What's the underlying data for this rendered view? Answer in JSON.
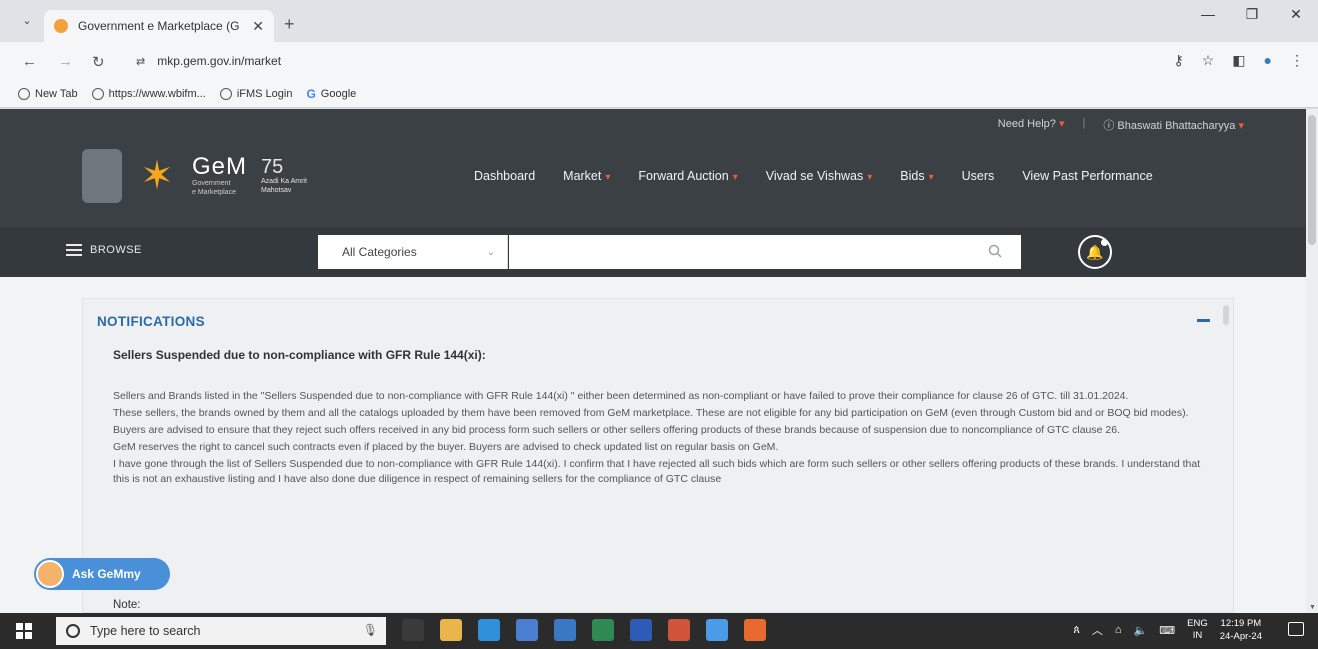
{
  "browser": {
    "tab_title": "Government e Marketplace (G",
    "url": "mkp.gem.gov.in/market",
    "bookmarks": [
      {
        "label": "New Tab",
        "icon": "globe-icon"
      },
      {
        "label": "https://www.wbifm...",
        "icon": "globe-icon"
      },
      {
        "label": "iFMS Login",
        "icon": "globe-icon"
      },
      {
        "label": "Google",
        "icon": "google-icon"
      }
    ]
  },
  "header": {
    "need_help": "Need Help?",
    "user_name": "Bhaswati Bhattacharyya",
    "logo_text": "GeM",
    "logo_sub1": "Government",
    "logo_sub2": "e Marketplace",
    "azadi_big": "75",
    "azadi_small": "Azadi Ka Amrit Mahotsav",
    "nav": [
      {
        "label": "Dashboard",
        "dropdown": false
      },
      {
        "label": "Market",
        "dropdown": true
      },
      {
        "label": "Forward Auction",
        "dropdown": true
      },
      {
        "label": "Vivad se Vishwas",
        "dropdown": true
      },
      {
        "label": "Bids",
        "dropdown": true
      },
      {
        "label": "Users",
        "dropdown": false
      },
      {
        "label": "View Past Performance",
        "dropdown": false
      }
    ],
    "accent_color": "#f05a36"
  },
  "browse": {
    "label": "BROWSE",
    "category": "All Categories",
    "search_value": ""
  },
  "notifications": {
    "title": "NOTIFICATIONS",
    "heading": "Sellers Suspended due to non-compliance with GFR Rule 144(xi):",
    "paragraphs": [
      "Sellers and Brands listed in the \"Sellers Suspended due to non-compliance with GFR Rule 144(xi) \" either been determined as non-compliant or have failed to prove their compliance for clause 26 of GTC. till 31.01.2024.",
      "These sellers, the brands owned by them and all the catalogs uploaded by them have been removed from GeM marketplace. These are not eligible for any bid participation on GeM (even through Custom bid and or BOQ bid modes).",
      "Buyers are advised to ensure that they reject such offers received in any bid process form such sellers or other sellers offering products of these brands because of suspension due to noncompliance of GTC clause 26.",
      "GeM reserves the right to cancel such contracts even if placed by the buyer. Buyers are advised to check updated list on regular basis on GeM.",
      "I have gone through the list of Sellers Suspended due to non-compliance with GFR Rule 144(xi). I confirm that I have rejected all such bids which are form such sellers or other sellers offering products of these brands. I understand that this is not an exhaustive listing and I have also done due diligence in respect of remaining sellers for the compliance of GTC clause"
    ],
    "note_label": "Note:",
    "title_color": "#2b6aa8"
  },
  "assistant": {
    "label": "Ask GeMmy"
  },
  "taskbar": {
    "search_placeholder": "Type here to search",
    "lang_top": "ENG",
    "lang_bottom": "IN",
    "time": "12:19 PM",
    "date": "24-Apr-24",
    "apps": [
      {
        "icon": "task-view-icon",
        "color": "#3a3a3a"
      },
      {
        "icon": "file-explorer-icon",
        "color": "#e8b64a"
      },
      {
        "icon": "edge-icon",
        "color": "#2f8fd8"
      },
      {
        "icon": "store-icon",
        "color": "#4a7fd0"
      },
      {
        "icon": "mail-icon",
        "color": "#3b78c4"
      },
      {
        "icon": "excel-icon",
        "color": "#2e8a52"
      },
      {
        "icon": "word-icon",
        "color": "#2d5bb6"
      },
      {
        "icon": "powerpoint-icon",
        "color": "#d0543a"
      },
      {
        "icon": "chrome-icon",
        "color": "#4c9be8"
      },
      {
        "icon": "firefox-icon",
        "color": "#e86a2e"
      }
    ]
  }
}
